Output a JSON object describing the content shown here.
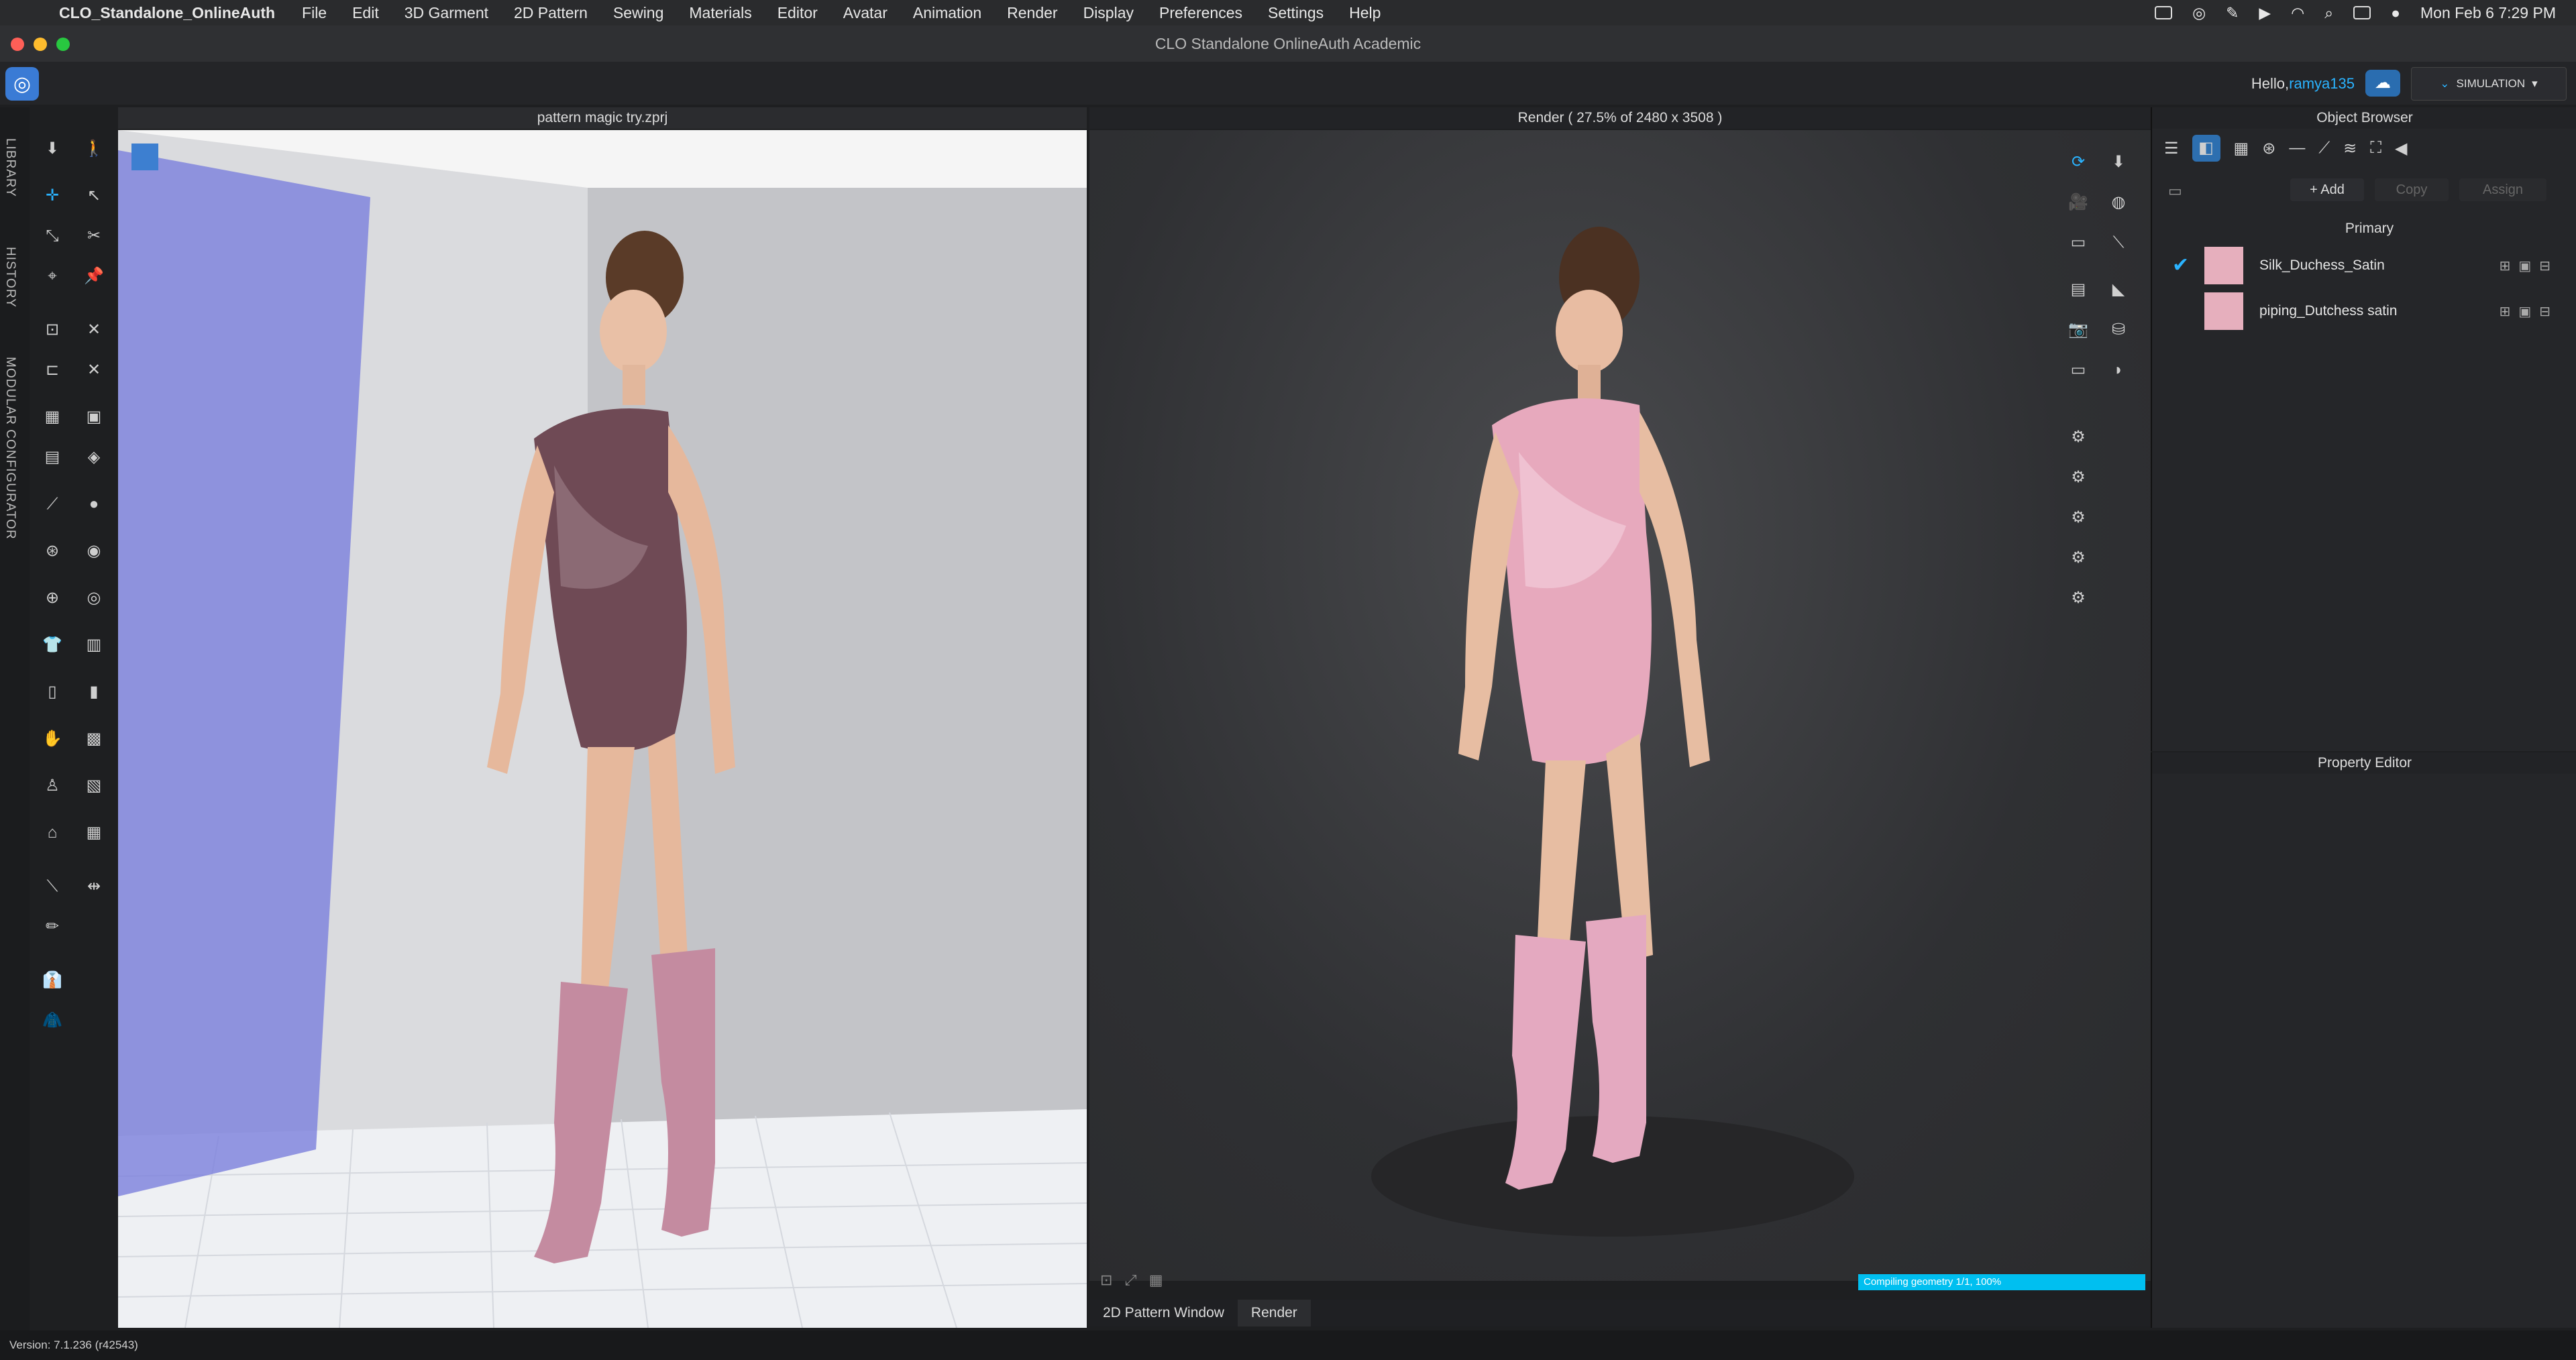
{
  "menubar": {
    "app_name": "CLO_Standalone_OnlineAuth",
    "items": [
      "File",
      "Edit",
      "3D Garment",
      "2D Pattern",
      "Sewing",
      "Materials",
      "Editor",
      "Avatar",
      "Animation",
      "Render",
      "Display",
      "Preferences",
      "Settings",
      "Help"
    ],
    "datetime": "Mon Feb 6  7:29 PM"
  },
  "window": {
    "title": "CLO Standalone OnlineAuth Academic"
  },
  "header": {
    "greeting": "Hello,",
    "username": "ramya135",
    "mode_label": "SIMULATION"
  },
  "sidebar_tabs": [
    "LIBRARY",
    "HISTORY",
    "MODULAR CONFIGURATOR"
  ],
  "viewport3d": {
    "title": "pattern magic try.zprj"
  },
  "render": {
    "title": "Render ( 27.5% of 2480 x 3508 )",
    "progress_text": "Compiling geometry 1/1, 100%",
    "progress": 1.0
  },
  "bottom_tabs": [
    "2D Pattern Window",
    "Render"
  ],
  "object_browser": {
    "title": "Object Browser",
    "add_label": "+ Add",
    "copy_label": "Copy",
    "assign_label": "Assign",
    "colorway": "Primary",
    "fabrics": [
      {
        "name": "Silk_Duchess_Satin",
        "color": "#e6afbd",
        "selected": true
      },
      {
        "name": "piping_Dutchess satin",
        "color": "#e6afbd",
        "selected": false
      }
    ]
  },
  "property_editor": {
    "title": "Property Editor"
  },
  "status": {
    "version": "Version: 7.1.236 (r42543)"
  },
  "colors": {
    "accent": "#2ab3ff",
    "progress": "#00bff0",
    "dress_left": "#6f4a55",
    "dress_right": "#e7a9bd",
    "boots": "#c48ba0"
  }
}
